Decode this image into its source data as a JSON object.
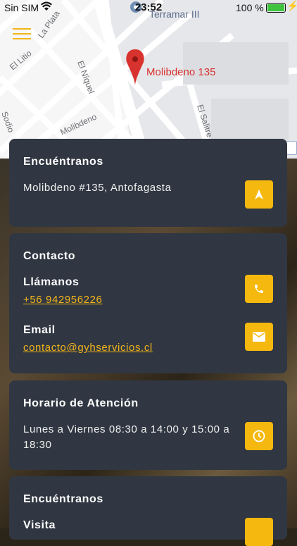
{
  "status_bar": {
    "carrier": "Sin SIM",
    "time": "23:52",
    "battery": "100 %"
  },
  "map": {
    "pin_label": "Molibdeno 135",
    "poi_label": "Terramar III",
    "streets": [
      "La Plata",
      "El Litio",
      "El Níquel",
      "Molibdeno",
      "Sodio",
      "El Salitre"
    ]
  },
  "cards": {
    "location": {
      "title": "Encuéntranos",
      "address": "Molibdeno #135, Antofagasta"
    },
    "contact": {
      "title": "Contacto",
      "call_label": "Llámanos",
      "phone": "+56 942956226",
      "email_label": "Email",
      "email": "contacto@gyhservicios.cl"
    },
    "hours": {
      "title": "Horario de Atención",
      "line1": "Lunes a Viernes 08:30 a 14:00 y 15:00 a",
      "line2": "18:30"
    },
    "visit": {
      "title": "Encuéntranos",
      "visit_label": "Visita"
    }
  },
  "colors": {
    "accent": "#f5b80e",
    "card": "#303742",
    "pin": "#d8322f"
  }
}
